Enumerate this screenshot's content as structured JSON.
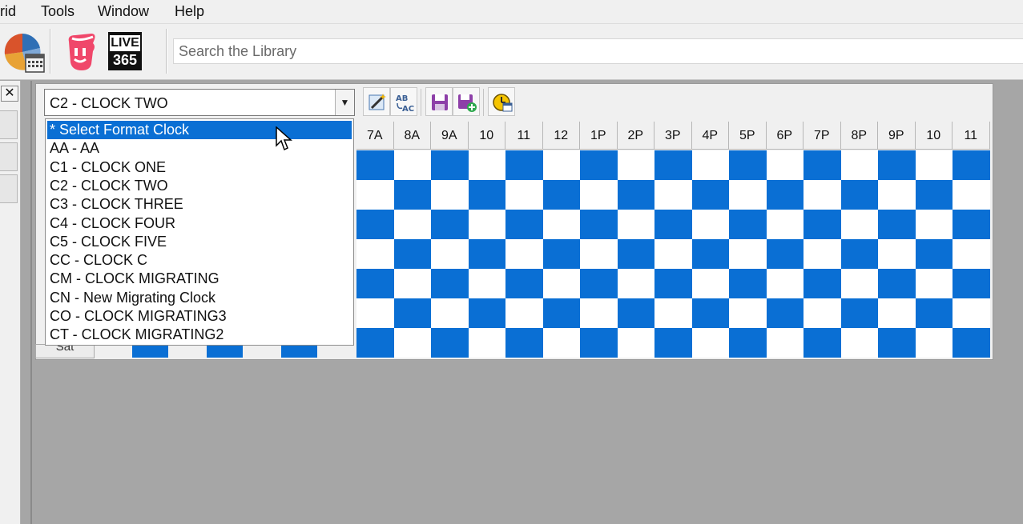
{
  "menu": [
    "rid",
    "Tools",
    "Window",
    "Help"
  ],
  "toolbar": {
    "live365_line1": "LIVE",
    "live365_line2": "365",
    "search_placeholder": "Search the Library"
  },
  "left_strip": {
    "close_label": "✕"
  },
  "format_clock": {
    "selected": "C2 - CLOCK TWO",
    "options": [
      "* Select Format Clock",
      "AA - AA",
      "C1 - CLOCK ONE",
      "C2 - CLOCK TWO",
      "C3 - CLOCK THREE",
      "C4 - CLOCK FOUR",
      "C5 - CLOCK FIVE",
      "CC - CLOCK C",
      "CM - CLOCK MIGRATING",
      "CN - New Migrating Clock",
      "CO - CLOCK MIGRATING3",
      "CT - CLOCK MIGRATING2"
    ],
    "highlighted_index": 0
  },
  "grid_tools": [
    "wand-icon",
    "spellcheck-icon",
    "save-icon",
    "save-new-icon",
    "clock-schedule-icon"
  ],
  "hours": [
    "7A",
    "8A",
    "9A",
    "10",
    "11",
    "12",
    "1P",
    "2P",
    "3P",
    "4P",
    "5P",
    "6P",
    "7P",
    "8P",
    "9P",
    "10",
    "11"
  ],
  "day_rows": 7,
  "partial_day_label": "Sat",
  "colors": {
    "accent": "#0a6fd4",
    "cell_empty": "#ffffff",
    "workspace": "#a6a6a6",
    "chrome": "#f0f0f0"
  }
}
